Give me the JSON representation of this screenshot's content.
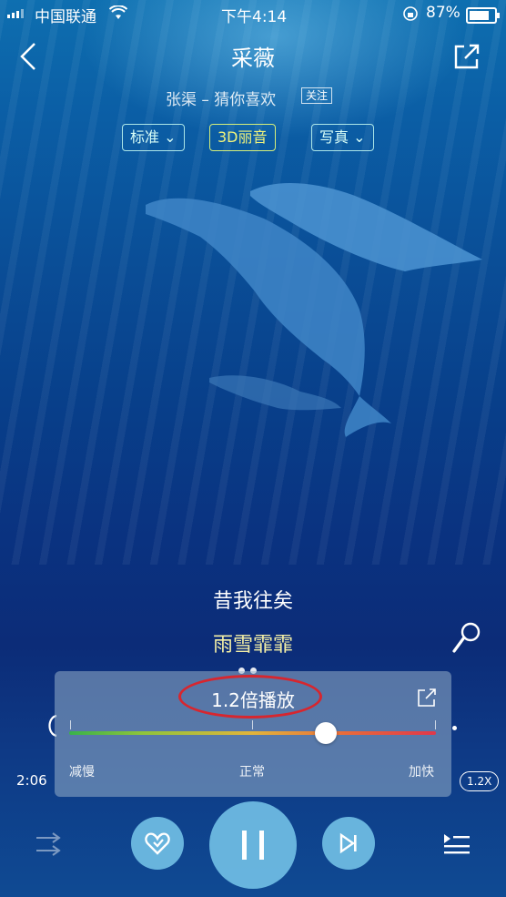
{
  "status_bar": {
    "carrier": "中国联通",
    "time": "下午4:14",
    "battery": "87%"
  },
  "song": {
    "title": "采薇",
    "artist_line": "张渠 – 猜你喜欢",
    "follow_label": "关注"
  },
  "quality_pills": {
    "standard": "标准",
    "audio_3d": "3D丽音",
    "portrait": "写真"
  },
  "lyrics": {
    "line1": "昔我往矣",
    "line2": "雨雪霏霏"
  },
  "speed_popup": {
    "title": "1.2倍播放",
    "label_slow": "减慢",
    "label_normal": "正常",
    "label_fast": "加快",
    "speed_value": 1.2,
    "slider_fraction": 0.7
  },
  "playback": {
    "elapsed": "2:06",
    "speed_badge": "1.2X"
  },
  "colors": {
    "accent_yellow": "#f0f37c",
    "button_blue": "#78c8eb",
    "highlight_red": "#d7262e"
  },
  "icons": [
    "back-icon",
    "share-icon",
    "mic-icon",
    "external-icon",
    "shuffle-icon",
    "like-icon",
    "pause-icon",
    "next-icon",
    "playlist-icon"
  ]
}
